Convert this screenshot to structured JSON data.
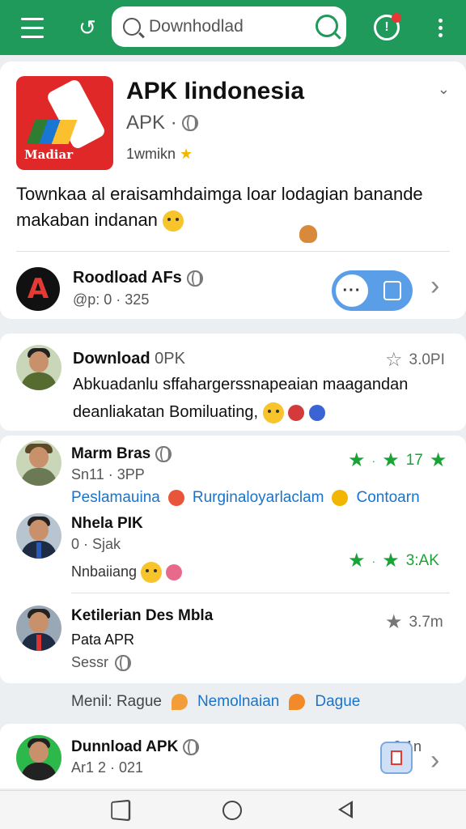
{
  "topbar": {
    "search_value": "Downhodlad",
    "colors": {
      "accent": "#1f9a5a"
    },
    "icons": [
      "menu-icon",
      "back-icon",
      "search-icon",
      "notification-icon",
      "more-icon"
    ]
  },
  "app_card": {
    "icon_text": "Madiar",
    "title": "APK Iindonesia",
    "subtitle": "APK ·",
    "rating_text": "1wmikn",
    "description": "Townkaa al eraisamhdaimga loar lodagian banande makaban indanan",
    "download_row": {
      "logo_letter": "A",
      "title": "Roodload AFs",
      "meta": "@p: 0 · 325"
    }
  },
  "post": {
    "title": "Download",
    "title_suffix": "0PK",
    "count": "3.0PI",
    "text": "Abkuadanlu sffahargerssnapeaian maagandan deanliakatan Bomiluating,"
  },
  "list": {
    "items": [
      {
        "name": "Marm Bras",
        "sub": "Sn11 · 3PP",
        "rating": "17",
        "link1": "Peslamauina",
        "link2": "Rurginaloyarlaclam",
        "link3": "Contoarn"
      },
      {
        "name": "Nhela PIK",
        "sub": "0 · Sjak",
        "rating": "3:AK",
        "text": "Nnbaiiang"
      },
      {
        "name": "Ketilerian Des Mbla",
        "name2": "Pata APR",
        "sub": "Sessr",
        "rating": "3.7m"
      }
    ]
  },
  "tags": {
    "label": "Menil: Rague",
    "t1": "Nemolnaian",
    "t2": "Dague"
  },
  "bottom": {
    "title": "Dunnload APK",
    "sub": "Ar1 2 · 021",
    "count": "3.1n"
  }
}
